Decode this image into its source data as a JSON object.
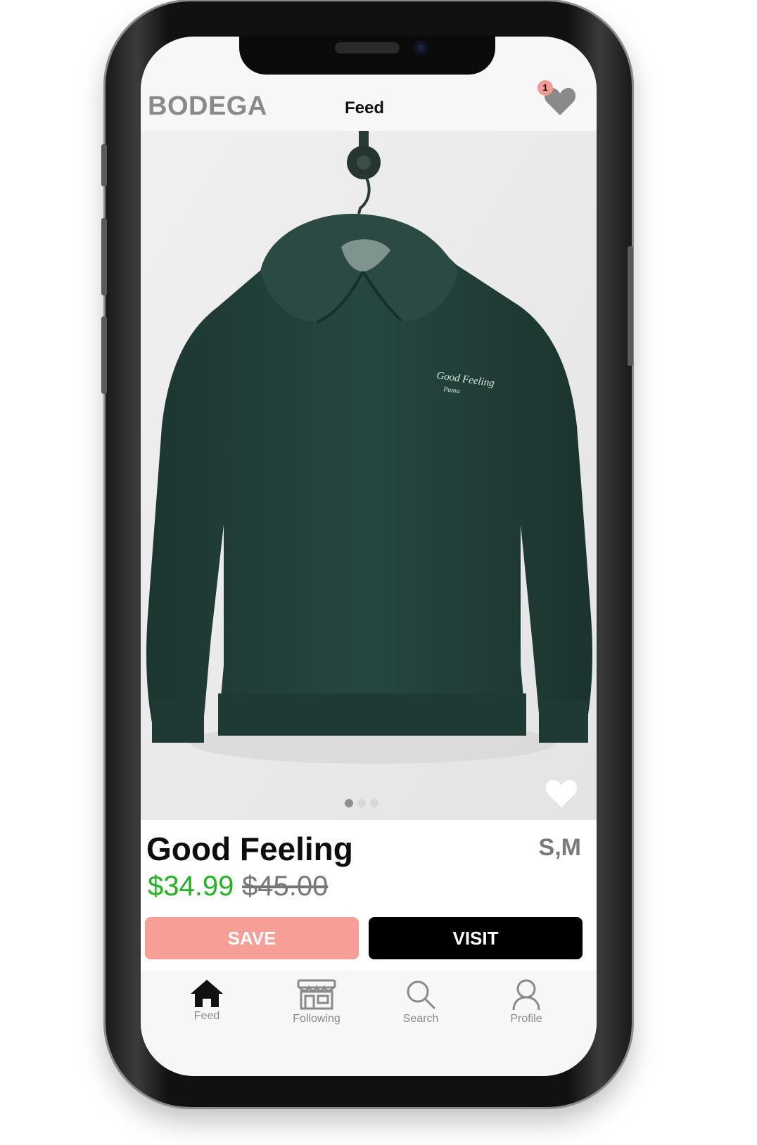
{
  "header": {
    "brand": "BODEGA",
    "title": "Feed",
    "saved_count": "1"
  },
  "product": {
    "image_alt_icon": "hoodie-image",
    "name": "Good Feeling",
    "sizes": "S,M",
    "price": "$34.99",
    "original_price": "$45.00",
    "image_count": 3,
    "active_image": 1,
    "hoodie_print": "Good Feeling"
  },
  "actions": {
    "save_label": "SAVE",
    "visit_label": "VISIT"
  },
  "tabbar": {
    "items": [
      {
        "label": "Feed",
        "icon": "home-icon"
      },
      {
        "label": "Following",
        "icon": "store-icon"
      },
      {
        "label": "Search",
        "icon": "search-icon"
      },
      {
        "label": "Profile",
        "icon": "profile-icon"
      }
    ]
  },
  "colors": {
    "price_green": "#22b323",
    "save_pink": "#f79e96",
    "hoodie_green": "#213f39"
  }
}
